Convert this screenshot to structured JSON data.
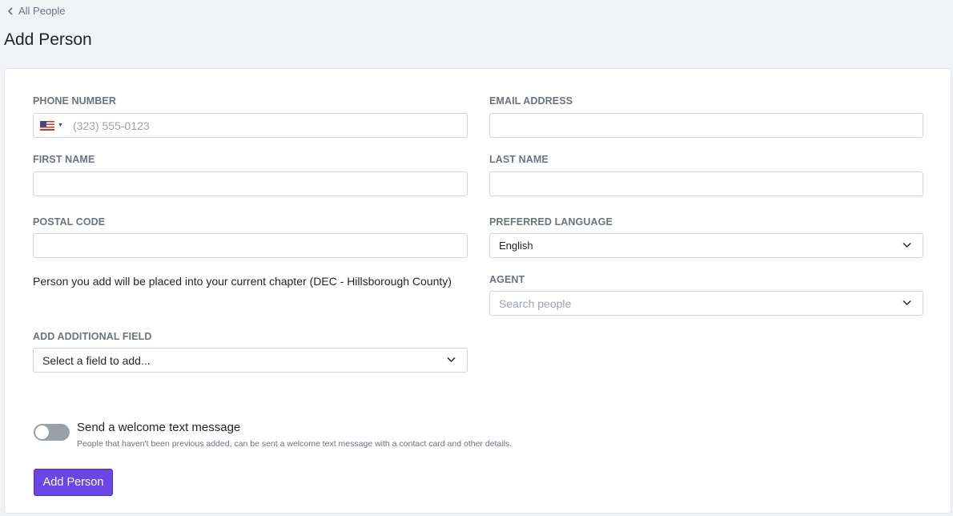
{
  "nav": {
    "back_label": "All People"
  },
  "page": {
    "title": "Add Person"
  },
  "form": {
    "phone": {
      "label": "PHONE NUMBER",
      "placeholder": "(323) 555-0123",
      "value": ""
    },
    "email": {
      "label": "EMAIL ADDRESS",
      "value": ""
    },
    "first_name": {
      "label": "FIRST NAME",
      "value": ""
    },
    "last_name": {
      "label": "LAST NAME",
      "value": ""
    },
    "postal_code": {
      "label": "POSTAL CODE",
      "value": ""
    },
    "preferred_language": {
      "label": "PREFERRED LANGUAGE",
      "selected": "English"
    },
    "chapter_notice": "Person you add will be placed into your current chapter (DEC - Hillsborough County)",
    "agent": {
      "label": "AGENT",
      "placeholder": "Search people"
    },
    "additional_field": {
      "label": "ADD ADDITIONAL FIELD",
      "selected": "Select a field to add..."
    },
    "welcome": {
      "title": "Send a welcome text message",
      "description": "People that haven't been previous added, can be sent a welcome text message with a contact card and other details.",
      "enabled": false
    },
    "submit_label": "Add Person"
  },
  "colors": {
    "primary": "#6b46e5",
    "toggle_off": "#9aa0a8",
    "background": "#f2f3f7"
  },
  "icons": {
    "back": "chevron-left-icon",
    "dropdown": "chevron-down-icon",
    "flag": "us-flag-icon"
  }
}
